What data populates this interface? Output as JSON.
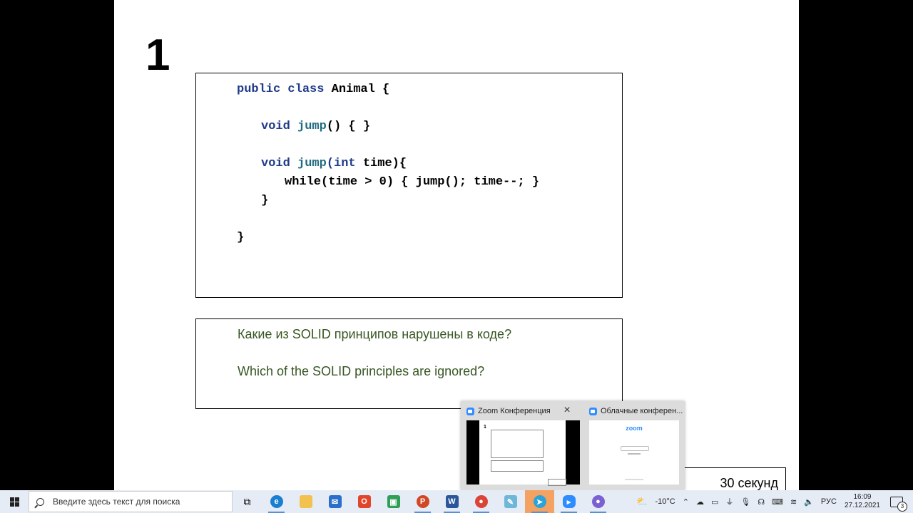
{
  "slide": {
    "number": "1",
    "code_lines": {
      "l1": {
        "kw": "public class",
        "rest": " Animal {"
      },
      "l2": {
        "kw": "void",
        "fn": " jump",
        "rest": "() { }"
      },
      "l3": {
        "kw": "void",
        "fn": " jump",
        "kw2": "(int",
        "rest": " time){"
      },
      "l4": {
        "rest": "while(time > 0) { jump(); time--; }"
      },
      "l5": {
        "rest": "}"
      },
      "l6": {
        "rest": "}"
      }
    },
    "question_ru": "Какие из SOLID принципов нарушены в коде?",
    "question_en": "Which of the SOLID principles are ignored?",
    "timer": "30 секунд"
  },
  "preview": {
    "card1_title": "Zoom Конференция",
    "card2_title": "Облачные конферен...",
    "thumb1_number": "1",
    "thumb2_logo": "zoom"
  },
  "taskbar": {
    "search_placeholder": "Введите здесь текст для поиска",
    "weather": "-10°C",
    "language": "РУС",
    "time": "16:09",
    "date": "27.12.2021",
    "notifications": "3"
  },
  "colors": {
    "code_keyword": "#1f3b8a",
    "code_function": "#1f6b80",
    "question_text": "#375623",
    "taskbar_bg": "#e6ecf5",
    "active_app": "#f4a261"
  }
}
